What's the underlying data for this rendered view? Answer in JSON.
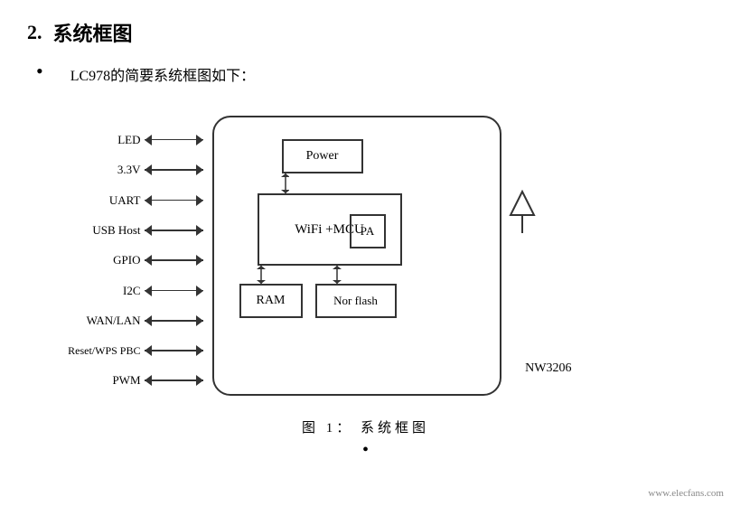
{
  "section": {
    "number": "2.",
    "title": "系统框图"
  },
  "bullet_text": "LC978的简要系统框图如下：",
  "diagram": {
    "interface_labels": [
      "LED",
      "3.3V",
      "UART",
      "USB Host",
      "GPIO",
      "I2C",
      "WAN/LAN",
      "Reset/WPS PBC",
      "PWM"
    ],
    "boxes": {
      "power": "Power",
      "wifi_mcu": "WiFi +MCU",
      "pa": "PA",
      "ram": "RAM",
      "norflash": "Nor flash",
      "chip_label": "NW3206"
    }
  },
  "caption": "图 1：   系统框图",
  "watermark": "www.elecfans.com"
}
